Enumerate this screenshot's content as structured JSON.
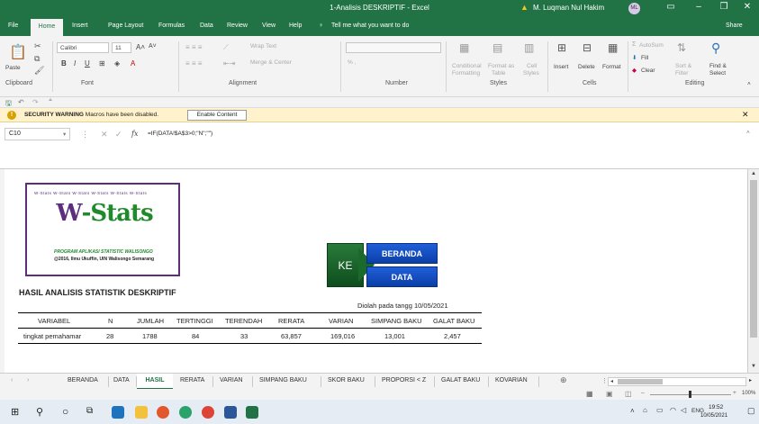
{
  "window": {
    "title": "1-Analisis DESKRIPTIF  -  Excel",
    "user": "M. Luqman Nul Hakim",
    "avatar": "ML"
  },
  "menu": [
    "File",
    "Home",
    "Insert",
    "Page Layout",
    "Formulas",
    "Data",
    "Review",
    "View",
    "Help"
  ],
  "tell_me": "Tell me what you want to do",
  "share": "Share",
  "ribbon": {
    "paste": "Paste",
    "clipboard": "Clipboard",
    "font_name": "Calibri",
    "font_size": "11",
    "font_group": "Font",
    "wrap_text": "Wrap Text",
    "merge_center": "Merge & Center",
    "alignment_group": "Alignment",
    "number_group": "Number",
    "number_symbols": "% ,",
    "conditional": "Conditional",
    "formatting": "Formatting",
    "format_as": "Format as",
    "table": "Table",
    "cell": "Cell",
    "styles": "Styles",
    "styles_group": "Styles",
    "insert": "Insert",
    "delete": "Delete",
    "format": "Format",
    "cells_group": "Cells",
    "autosum": "AutoSum",
    "fill": "Fill",
    "clear": "Clear",
    "sort_filter": "Sort &",
    "filter": "Filter",
    "find_select": "Find &",
    "select": "Select",
    "editing_group": "Editing"
  },
  "security": {
    "title": "SECURITY WARNING",
    "message": "Macros have been disabled.",
    "button": "Enable Content"
  },
  "formula_bar": {
    "name_box": "C10",
    "fx": "fx",
    "formula": "=IF(DATA!$A$3>0;\"N\";\"\")"
  },
  "logo": {
    "small": "W-Stats W-Stats W-Stats W-Stats W-Stats W-Stats",
    "title_w": "W",
    "title_rest": "-Stats",
    "sub1": "PROGRAM APLIKASI STATISTIC WALISONGO",
    "sub2": "@2016, Ilmu Ukuffin, UIN Walisongo Semarang"
  },
  "nav": {
    "ke": "KE",
    "beranda": "BERANDA",
    "data": "DATA"
  },
  "report": {
    "heading": "HASIL ANALISIS STATISTIK DESKRIPTIF",
    "processed": "Diolah pada tangg 10/05/2021",
    "headers": [
      "VARIABEL",
      "N",
      "JUMLAH",
      "TERTINGGI",
      "TERENDAH",
      "RERATA",
      "VARIAN",
      "SIMPANG BAKU",
      "GALAT BAKU"
    ],
    "row": [
      "tingkat pemahamar",
      "28",
      "1788",
      "84",
      "33",
      "63,857",
      "169,016",
      "13,001",
      "2,457"
    ]
  },
  "sheet_tabs": [
    "BERANDA",
    "DATA",
    "HASIL",
    "RERATA",
    "VARIAN",
    "SIMPANG BAKU",
    "SKOR BAKU",
    "PROPORSI < Z",
    "GALAT BAKU",
    "KOVARIAN"
  ],
  "status": {
    "zoom": "100%"
  },
  "taskbar": {
    "lang": "ENG",
    "time": "19:52",
    "date": "10/05/2021"
  }
}
